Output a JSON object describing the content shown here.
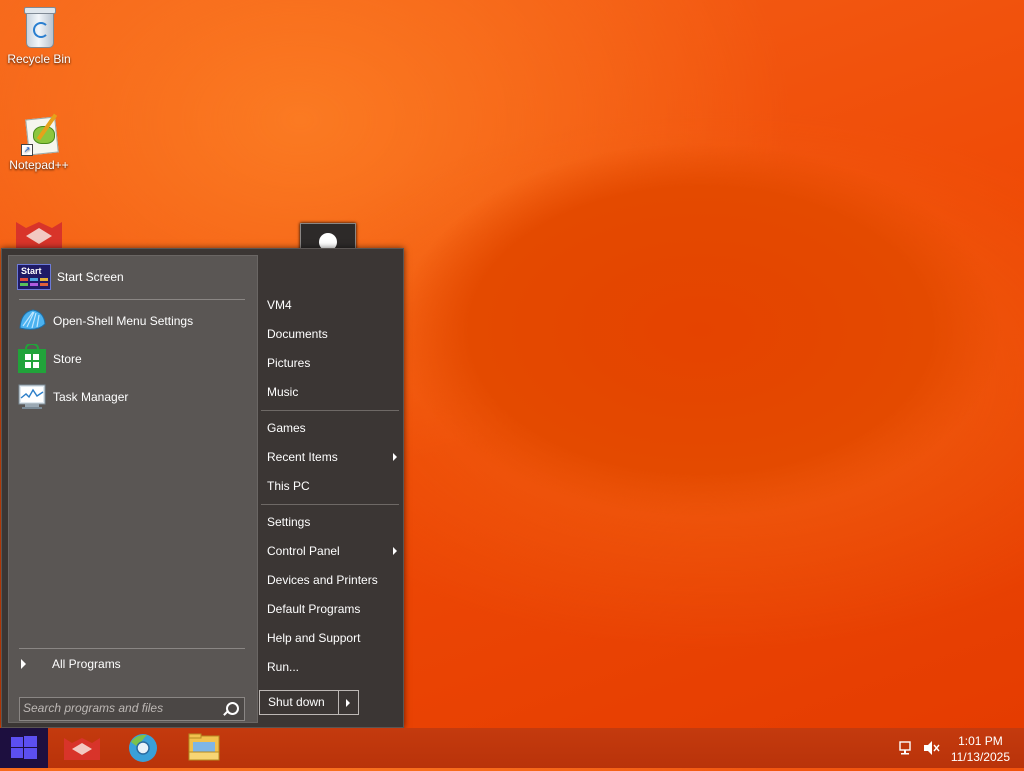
{
  "desktop": {
    "icons": [
      {
        "label": "Recycle Bin"
      },
      {
        "label": "Notepad++"
      }
    ]
  },
  "start_menu": {
    "left": {
      "start_screen": "Start Screen",
      "start_screen_icon_text": "Start",
      "items": [
        "Open-Shell Menu Settings",
        "Store",
        "Task Manager"
      ],
      "all_programs": "All Programs",
      "search_placeholder": "Search programs and files"
    },
    "right": {
      "items": [
        "VM4",
        "Documents",
        "Pictures",
        "Music",
        "Games",
        "Recent Items",
        "This PC",
        "Settings",
        "Control Panel",
        "Devices and Printers",
        "Default Programs",
        "Help and Support",
        "Run..."
      ],
      "shutdown": "Shut down"
    }
  },
  "taskbar": {
    "time": "1:01 PM",
    "date": "11/13/2025"
  },
  "colors": {
    "accent": "#5c4ff0",
    "taskbar": "#c1380c",
    "menu_bg": "#3b3634"
  }
}
